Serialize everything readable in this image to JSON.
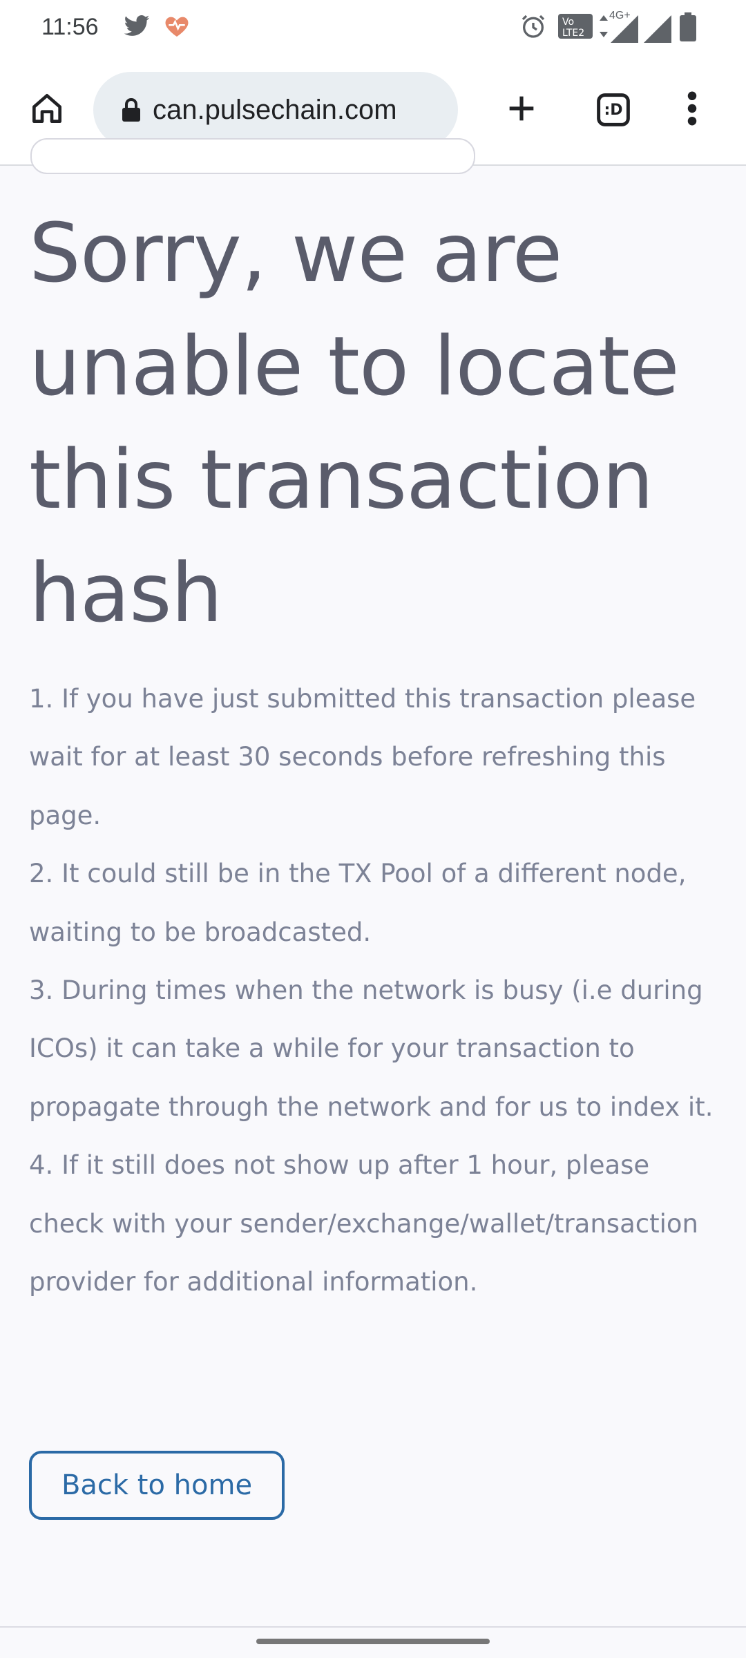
{
  "status_bar": {
    "time": "11:56",
    "icons": [
      "twitter-icon",
      "health-heart-icon",
      "alarm-icon",
      "volte-icon",
      "data-arrows-icon",
      "signal-icon",
      "battery-icon"
    ],
    "network_label": "4G+"
  },
  "browser": {
    "url": "can.pulsechain.com",
    "tab_count": ":D",
    "icons": [
      "home-icon",
      "lock-icon",
      "plus-icon",
      "tab-switcher-icon",
      "more-vert-icon"
    ]
  },
  "page": {
    "title": "Sorry, we are unable to locate this transaction hash",
    "items": [
      "1. If you have just submitted this transaction please wait for at least 30 seconds before refreshing this page.",
      "2. It could still be in the TX Pool of a different node, waiting to be broadcasted.",
      "3. During times when the network is busy (i.e during ICOs) it can take a while for your transaction to propagate through the network and for us to index it.",
      "4. If it still does not show up after 1 hour, please check with your sender/exchange/wallet/transaction provider for additional information."
    ],
    "back_button": "Back to home"
  },
  "colors": {
    "title": "#5a5c6b",
    "body_text": "#7c8296",
    "accent": "#2b6aa6",
    "background": "#f9f9fc"
  }
}
